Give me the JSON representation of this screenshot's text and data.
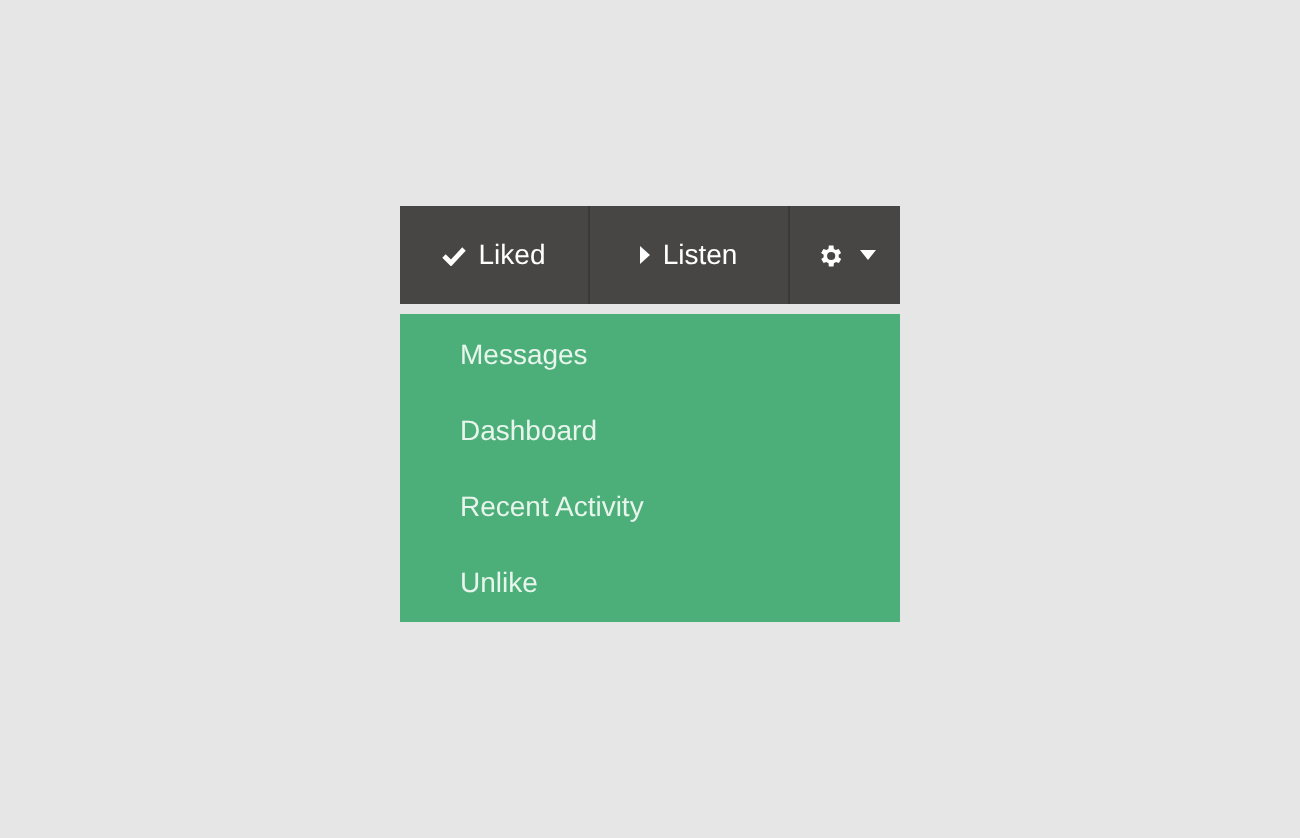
{
  "toolbar": {
    "buttons": [
      {
        "label": "Liked",
        "kind": "check"
      },
      {
        "label": "Listen",
        "kind": "play"
      }
    ],
    "settings": {
      "expanded": true
    }
  },
  "menu": {
    "items": [
      {
        "label": "Messages"
      },
      {
        "label": "Dashboard"
      },
      {
        "label": "Recent Activity"
      },
      {
        "label": "Unlike"
      }
    ]
  }
}
